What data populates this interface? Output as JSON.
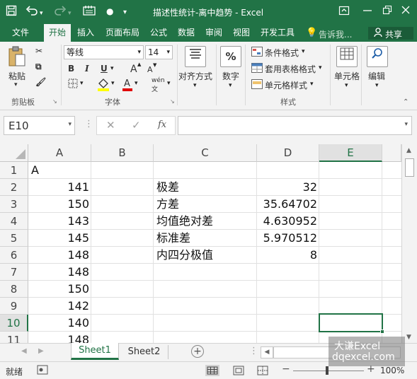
{
  "window": {
    "title": "描述性统计-离中趋势 - Excel",
    "account_label": "共享"
  },
  "tabs": [
    {
      "label": "文件"
    },
    {
      "label": "开始"
    },
    {
      "label": "插入"
    },
    {
      "label": "页面布局"
    },
    {
      "label": "公式"
    },
    {
      "label": "数据"
    },
    {
      "label": "审阅"
    },
    {
      "label": "视图"
    },
    {
      "label": "开发工具"
    }
  ],
  "tell_me": {
    "placeholder": "告诉我..."
  },
  "ribbon": {
    "paste_label": "粘贴",
    "clipboard_group": "剪贴板",
    "font_name": "等线",
    "font_size": "14",
    "bold": "B",
    "italic": "I",
    "underline": "U",
    "increase_font": "A",
    "decrease_font": "A",
    "font_group": "字体",
    "align_label": "对齐方式",
    "number_label": "数字",
    "number_icon": "%",
    "cond_format": "条件格式",
    "table_format": "套用表格格式",
    "cell_styles": "单元格样式",
    "styles_group": "样式",
    "cells_label": "单元格",
    "edit_label": "编辑"
  },
  "formula_bar": {
    "name_box": "E10",
    "fx": "fx",
    "value": ""
  },
  "grid": {
    "columns": [
      "A",
      "B",
      "C",
      "D",
      "E"
    ],
    "rows": [
      "1",
      "2",
      "3",
      "4",
      "5",
      "6",
      "7",
      "8",
      "9",
      "10",
      "11"
    ],
    "colA": [
      "A",
      "141",
      "150",
      "143",
      "145",
      "148",
      "148",
      "150",
      "142",
      "140",
      "148"
    ],
    "colC": [
      "",
      "极差",
      "方差",
      "均值绝对差",
      "标准差",
      "内四分极值"
    ],
    "colD": [
      "",
      "32",
      "35.64702",
      "4.630952",
      "5.970512",
      "8"
    ],
    "selected_cell": "E10"
  },
  "sheets": [
    {
      "label": "Sheet1",
      "active": true
    },
    {
      "label": "Sheet2",
      "active": false
    }
  ],
  "status": {
    "mode": "就绪",
    "zoom": "100%"
  },
  "watermark": {
    "line1": "大谦Excel",
    "line2": "dqexcel.com"
  }
}
